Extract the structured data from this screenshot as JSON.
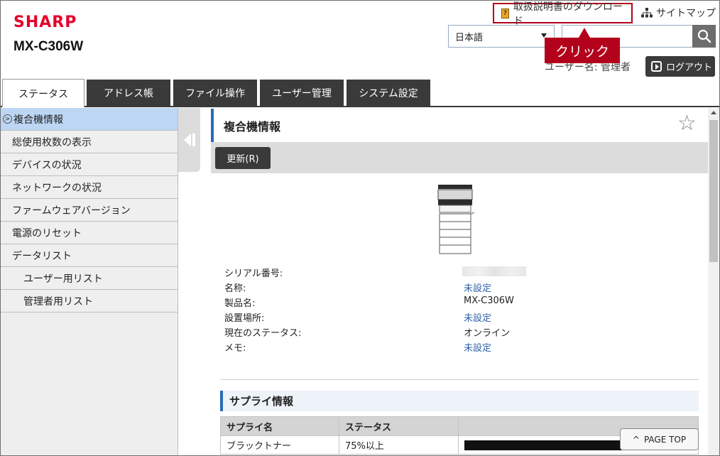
{
  "header": {
    "logo": "SHARP",
    "model": "MX-C306W",
    "manual_link": "取扱説明書のダウンロード",
    "sitemap_link": "サイトマップ",
    "language": "日本語",
    "search_value": "",
    "callout": "クリック",
    "user_label": "ユーザー名: 管理者",
    "logout": "ログアウト"
  },
  "tabs": [
    {
      "label": "ステータス",
      "active": true
    },
    {
      "label": "アドレス帳"
    },
    {
      "label": "ファイル操作"
    },
    {
      "label": "ユーザー管理"
    },
    {
      "label": "システム設定"
    }
  ],
  "sidebar": {
    "items": [
      {
        "label": "複合機情報",
        "active": true
      },
      {
        "label": "総使用枚数の表示"
      },
      {
        "label": "デバイスの状況"
      },
      {
        "label": "ネットワークの状況"
      },
      {
        "label": "ファームウェアバージョン"
      },
      {
        "label": "電源のリセット"
      },
      {
        "label": "データリスト"
      },
      {
        "label": "ユーザー用リスト",
        "sub": true
      },
      {
        "label": "管理者用リスト",
        "sub": true
      }
    ]
  },
  "main": {
    "title": "複合機情報",
    "refresh": "更新(R)",
    "info": [
      {
        "label": "シリアル番号:",
        "value": ""
      },
      {
        "label": "名称:",
        "value": "未設定"
      },
      {
        "label": "製品名:",
        "value": "MX-C306W"
      },
      {
        "label": "設置場所:",
        "value": "未設定"
      },
      {
        "label": "現在のステータス:",
        "value": "オンライン"
      },
      {
        "label": "メモ:",
        "value": "未設定"
      }
    ],
    "supply_title": "サプライ情報",
    "supply_table": {
      "headers": [
        "サプライ名",
        "ステータス"
      ],
      "rows": [
        {
          "name": "ブラックトナー",
          "status": "75%以上"
        }
      ]
    },
    "page_top": "PAGE TOP"
  },
  "colors": {
    "brand": "#e4002b",
    "accent": "#2a6bb5",
    "callout": "#b3001b",
    "link": "#2f62a8"
  }
}
